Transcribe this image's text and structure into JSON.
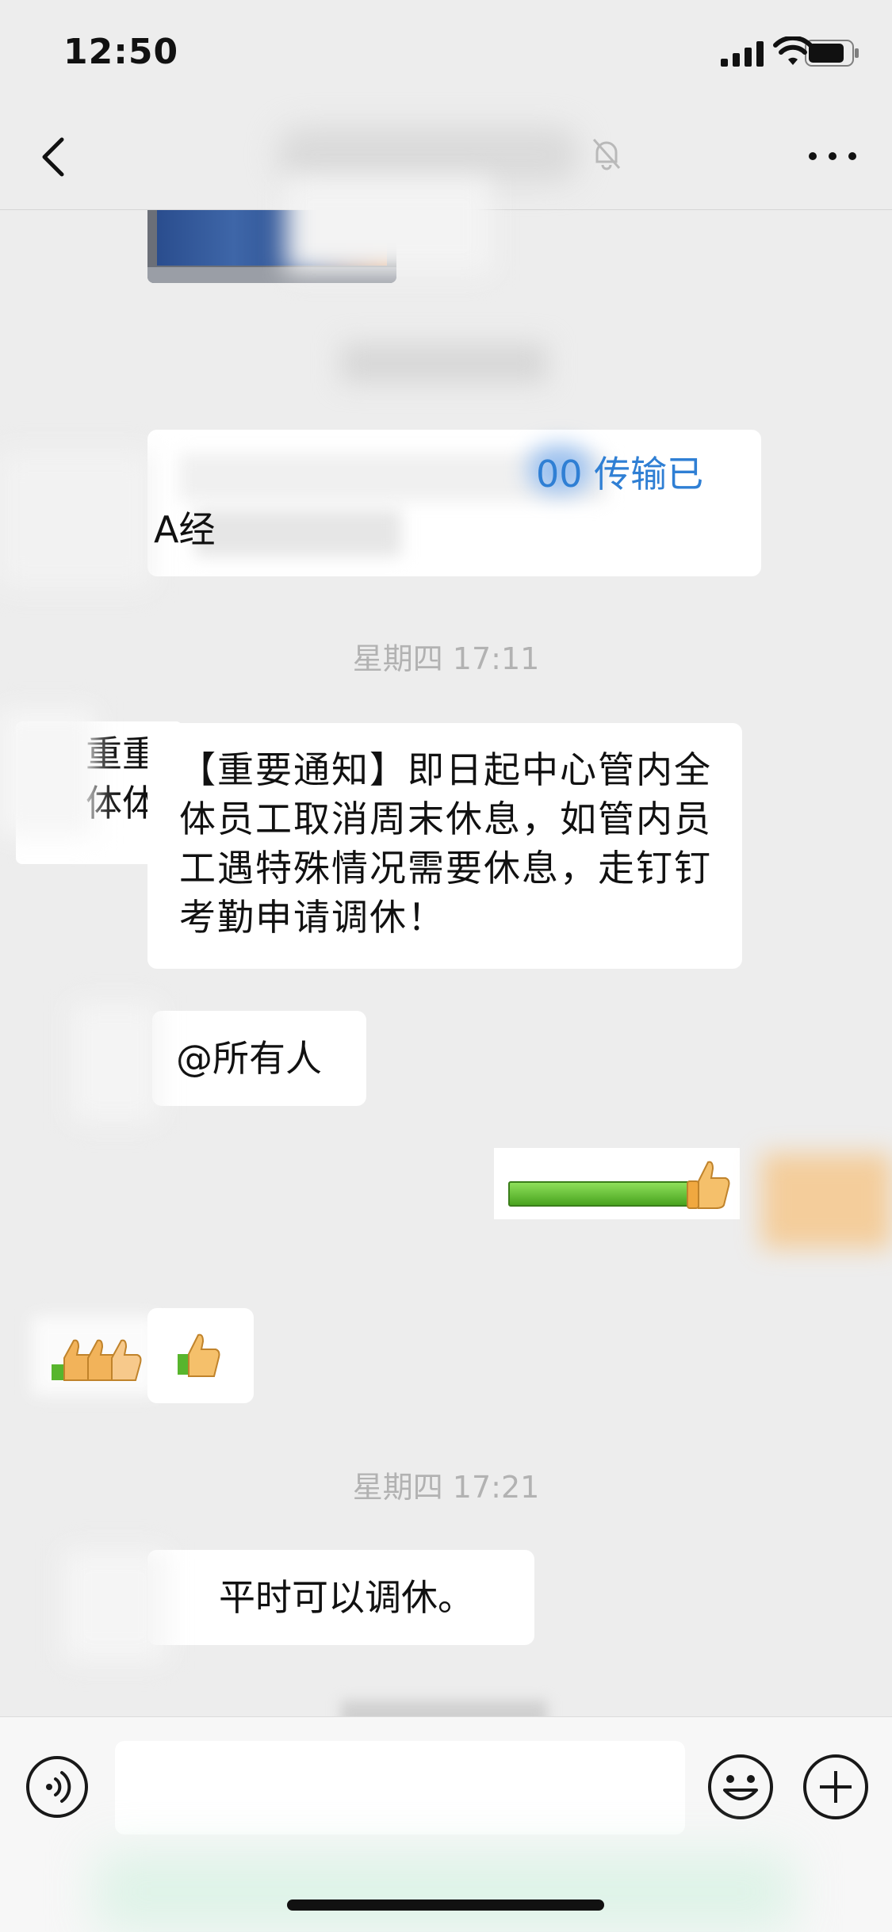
{
  "status_bar": {
    "time": "12:50"
  },
  "nav": {
    "title": "",
    "back_icon": "chevron-left-icon",
    "mute_icon": "bell-slash-icon",
    "more_icon": "more-horizontal-icon"
  },
  "messages": {
    "m1_visible_suffix": "00 传输已",
    "m1_line2_prefix": "A经",
    "timestamp1": "星期四 17:11",
    "notice_text": "【重要通知】即日起中心管内全体员工取消周末休息，如管内员工遇特殊情况需要休息，走钉钉考勤申请调休！",
    "at_all": "@所有人",
    "timestamp2": "星期四 17:21",
    "reply": "平时可以调休。"
  },
  "partial_left_text": {
    "line1": "重重",
    "line2": "体体"
  },
  "input": {
    "placeholder": ""
  },
  "colors": {
    "background": "#ededed",
    "bubble": "#ffffff",
    "timestamp": "#b2b2b2",
    "link_blue": "#2f7fd4",
    "thumb_green": "#58b52d"
  }
}
